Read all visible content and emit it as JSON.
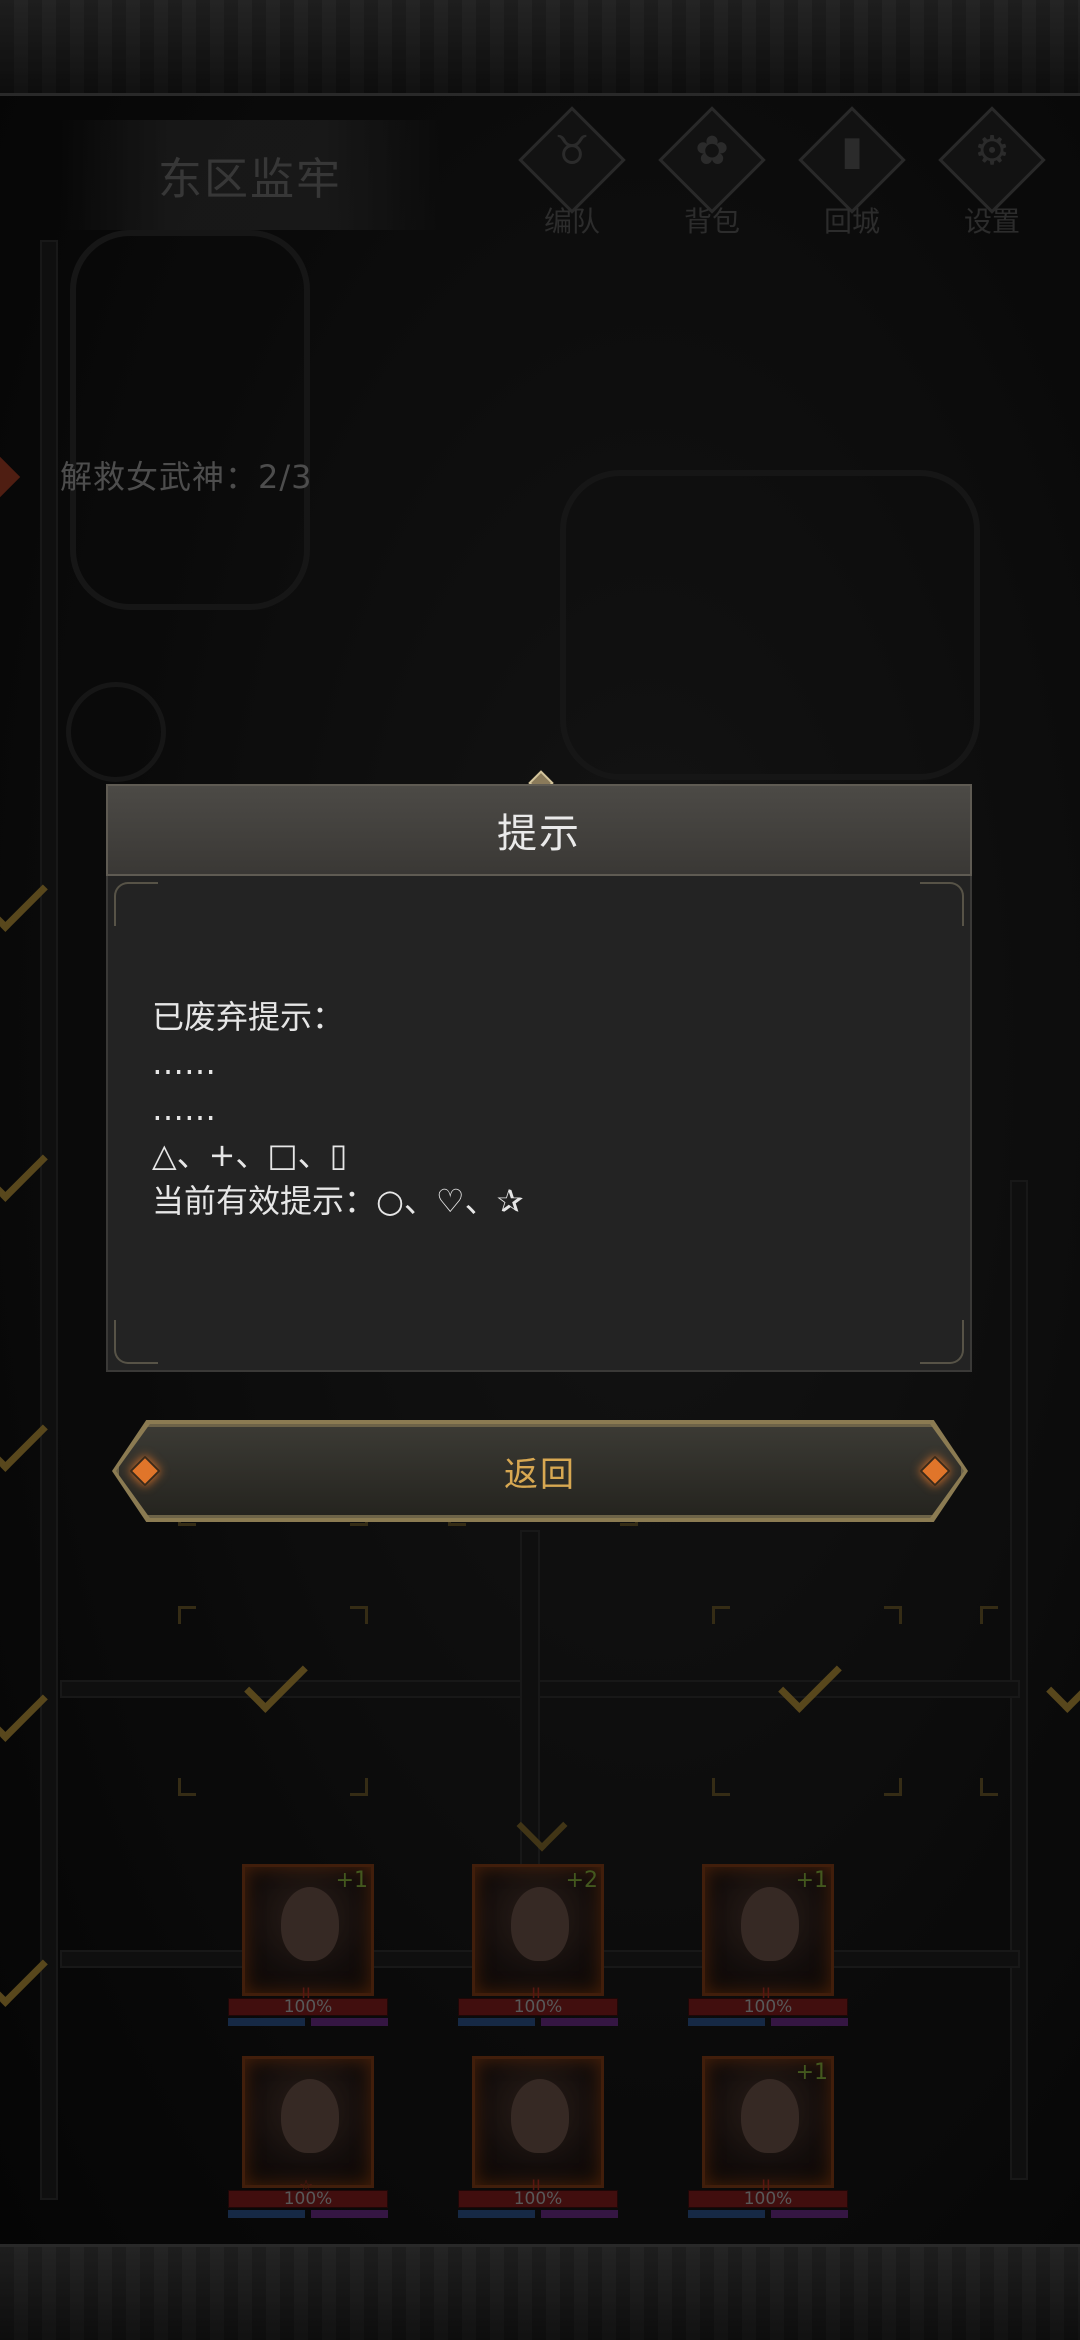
{
  "area": {
    "title": "东区监牢"
  },
  "top_menu": [
    {
      "label": "编队",
      "icon": "bull-skull-icon"
    },
    {
      "label": "背包",
      "icon": "bag-icon"
    },
    {
      "label": "回城",
      "icon": "door-icon"
    },
    {
      "label": "设置",
      "icon": "gear-icon"
    }
  ],
  "progress": {
    "label": "解救女武神：",
    "value": "2/3"
  },
  "dialog": {
    "title": "提示",
    "lines": [
      "已废弃提示：",
      "……",
      "……",
      "△、+、□、▯",
      "当前有效提示：○、♡、✰"
    ],
    "back_label": "返回"
  },
  "heroes": [
    {
      "bonus": "+1",
      "rank": "II",
      "hp": "100%"
    },
    {
      "bonus": "+2",
      "rank": "II",
      "hp": "100%"
    },
    {
      "bonus": "+1",
      "rank": "II",
      "hp": "100%"
    },
    {
      "bonus": "",
      "rank": "☆",
      "hp": "100%"
    },
    {
      "bonus": "",
      "rank": "II",
      "hp": "100%"
    },
    {
      "bonus": "+1",
      "rank": "II",
      "hp": "100%"
    }
  ],
  "colors": {
    "accent_gold": "#d8a852",
    "gem_orange": "#e0752a"
  }
}
